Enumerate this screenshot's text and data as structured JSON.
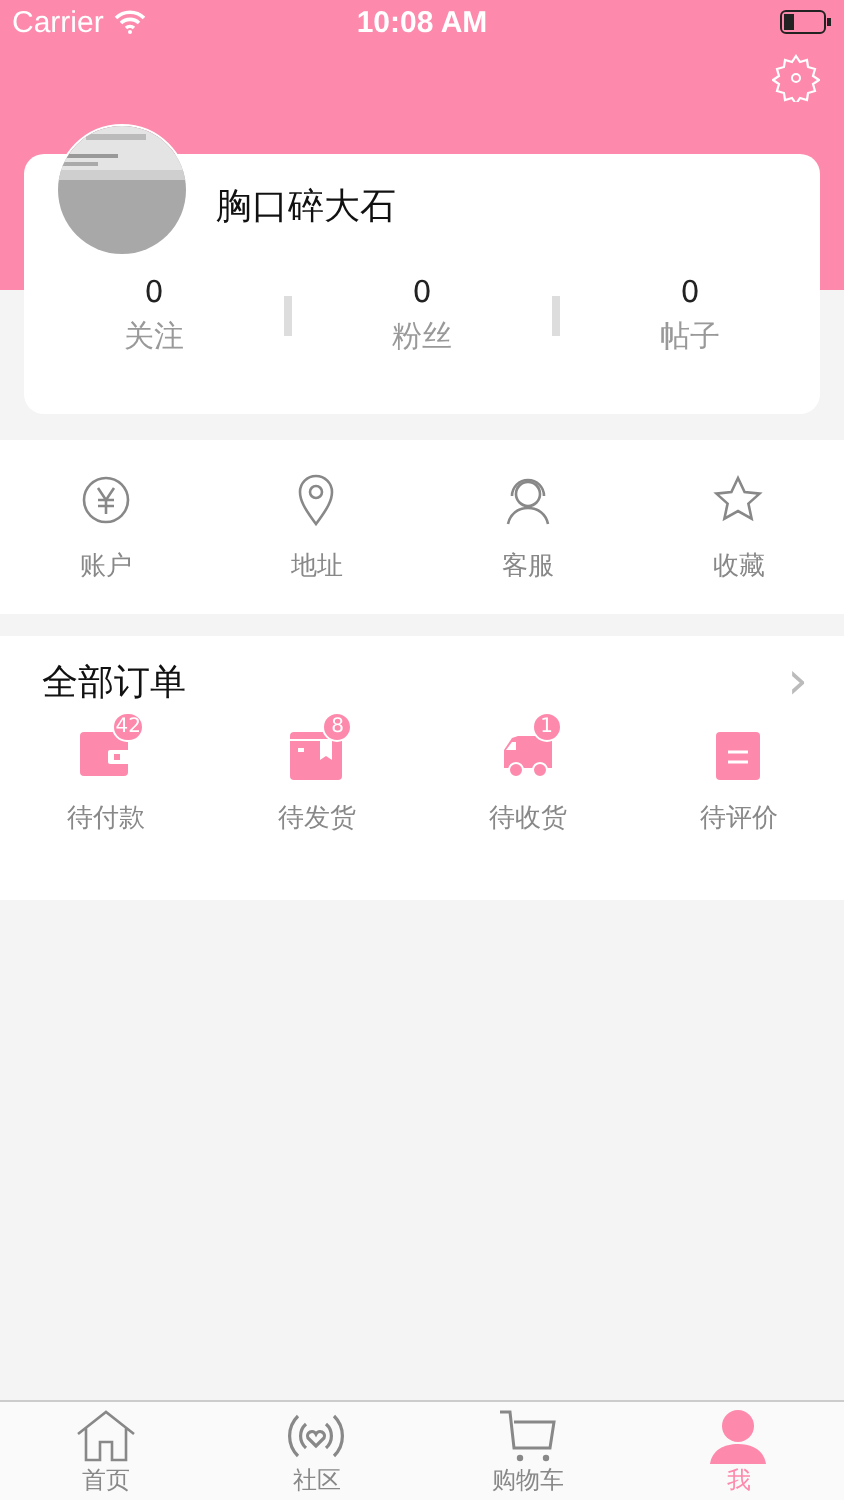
{
  "status_bar": {
    "carrier": "Carrier",
    "time": "10:08 AM"
  },
  "profile": {
    "name": "胸口碎大石",
    "stats": [
      {
        "value": "0",
        "label": "关注"
      },
      {
        "value": "0",
        "label": "粉丝"
      },
      {
        "value": "0",
        "label": "帖子"
      }
    ]
  },
  "services": [
    {
      "kind": "yen",
      "label": "账户"
    },
    {
      "kind": "pin",
      "label": "地址"
    },
    {
      "kind": "headset",
      "label": "客服"
    },
    {
      "kind": "star",
      "label": "收藏"
    }
  ],
  "orders": {
    "title": "全部订单",
    "chevron": "›",
    "items": [
      {
        "kind": "wallet",
        "label": "待付款",
        "badge": "42"
      },
      {
        "kind": "box",
        "label": "待发货",
        "badge": "8"
      },
      {
        "kind": "truck",
        "label": "待收货",
        "badge": "1"
      },
      {
        "kind": "note",
        "label": "待评价"
      }
    ]
  },
  "tabs": [
    {
      "kind": "home",
      "label": "首页",
      "selected": false
    },
    {
      "kind": "signal",
      "label": "社区",
      "selected": false
    },
    {
      "kind": "cart",
      "label": "购物车",
      "selected": false
    },
    {
      "kind": "person",
      "label": "我",
      "selected": true
    }
  ]
}
